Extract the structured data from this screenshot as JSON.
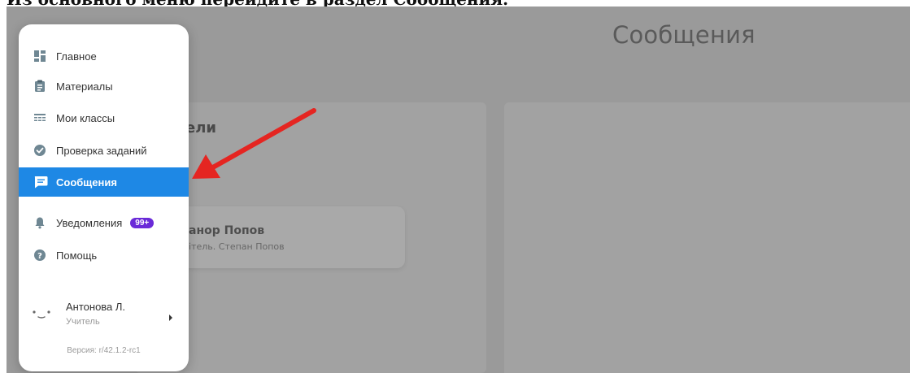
{
  "caption": "Из основного меню перейдите в раздел Сообщения.",
  "page": {
    "title": "Сообщения",
    "panel_heading": "ели",
    "contact": {
      "name": "анор Попов",
      "subtitle": "ітель. Степан Попов"
    }
  },
  "menu": {
    "items": [
      {
        "label": "Главное",
        "icon": "dashboard-icon"
      },
      {
        "label": "Материалы",
        "icon": "clipboard-icon"
      },
      {
        "label": "Мои классы",
        "icon": "table-icon"
      },
      {
        "label": "Проверка заданий",
        "icon": "check-circle-icon"
      },
      {
        "label": "Сообщения",
        "icon": "chat-icon",
        "active": true
      },
      {
        "label": "Уведомления",
        "icon": "bell-icon",
        "badge": "99+"
      },
      {
        "label": "Помощь",
        "icon": "help-icon"
      }
    ],
    "user": {
      "name": "Антонова Л.",
      "role": "Учитель"
    },
    "version": "Версия: r/42.1.2-rc1"
  },
  "colors": {
    "accent": "#1e88e5",
    "badge": "#6a2ad8",
    "arrow": "#e52521",
    "overlay": "#9a9a9a"
  }
}
